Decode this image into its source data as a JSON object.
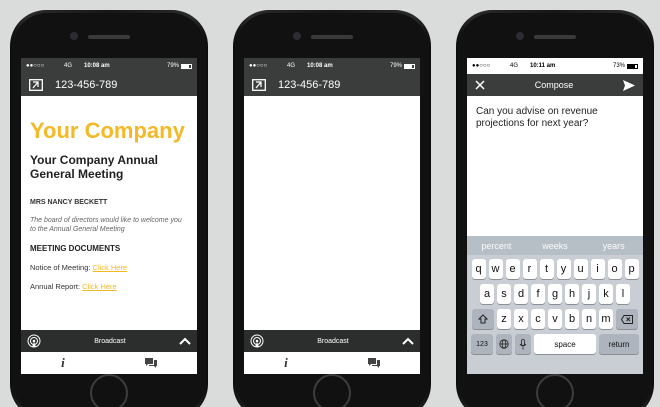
{
  "status_left": {
    "carrier": "●●○○○",
    "network": "4G",
    "time": "10:08 am",
    "battery": "79%",
    "battery_level": 0.79
  },
  "status_right": {
    "carrier": "●●○○○",
    "network": "4G",
    "time": "10:11 am",
    "battery": "73%",
    "battery_level": 0.73
  },
  "appbar": {
    "phone_number": "123-456-789"
  },
  "event": {
    "brand": "Your Company",
    "meeting_title": "Your Company Annual General Meeting",
    "attendee": "MRS NANCY BECKETT",
    "welcome": "The board of directors would like to welcome you to the Annual General Meeting",
    "documents_header": "MEETING DOCUMENTS",
    "notice_label": "Notice of Meeting:",
    "annual_label": "Annual Report:",
    "link_text": "Click Here"
  },
  "broadcast": {
    "label": "Broadcast"
  },
  "compose": {
    "title": "Compose",
    "message": "Can you advise on revenue projections for next year?"
  },
  "keyboard": {
    "suggestions": [
      "percent",
      "weeks",
      "years"
    ],
    "row1": [
      "q",
      "w",
      "e",
      "r",
      "t",
      "y",
      "u",
      "i",
      "o",
      "p"
    ],
    "row2": [
      "a",
      "s",
      "d",
      "f",
      "g",
      "h",
      "j",
      "k",
      "l"
    ],
    "row3": [
      "z",
      "x",
      "c",
      "v",
      "b",
      "n",
      "m"
    ],
    "numbers": "123",
    "space": "space",
    "return": "return"
  },
  "colors": {
    "accent": "#f5b826",
    "bar": "#3a3d3c",
    "broadcast_bar": "#2c2e2e",
    "background": "#dadcdc"
  },
  "icons": [
    "exit-icon",
    "broadcast-icon",
    "chevron-up-icon",
    "info-icon",
    "chat-icon",
    "close-icon",
    "send-icon",
    "shift-icon",
    "globe-icon",
    "microphone-icon",
    "backspace-icon"
  ]
}
